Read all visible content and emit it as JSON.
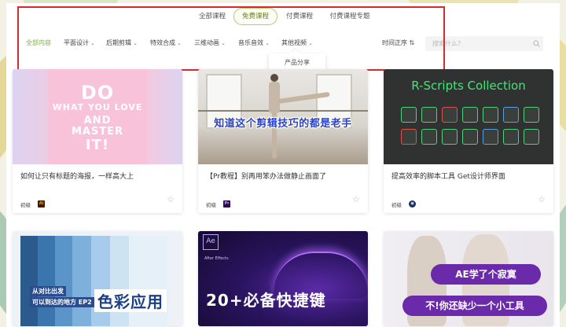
{
  "tabs": [
    {
      "label": "全部课程",
      "active": false
    },
    {
      "label": "免费课程",
      "active": true
    },
    {
      "label": "付费课程",
      "active": false
    },
    {
      "label": "付费课程专题",
      "active": false
    }
  ],
  "filters": [
    {
      "label": "全部内容",
      "active": true,
      "has_chevron": false
    },
    {
      "label": "平面设计",
      "active": false,
      "has_chevron": true
    },
    {
      "label": "后期剪辑",
      "active": false,
      "has_chevron": true
    },
    {
      "label": "特效合成",
      "active": false,
      "has_chevron": true
    },
    {
      "label": "三维动画",
      "active": false,
      "has_chevron": true
    },
    {
      "label": "音乐音效",
      "active": false,
      "has_chevron": true
    },
    {
      "label": "其他视频",
      "active": false,
      "has_chevron": true
    }
  ],
  "sort": {
    "label": "时间正序",
    "icon": "sort-arrows-icon"
  },
  "search": {
    "placeholder": "搜索什么?",
    "value": "",
    "icon": "search-icon"
  },
  "dropdown": {
    "item": "产品分享"
  },
  "colors": {
    "accent": "#7ab32a",
    "highlight": "#e0262d",
    "active_tab_border": "#b5c97a"
  },
  "cards": [
    {
      "title": "如何让只有标题的海报，一样高大上",
      "level": "初级",
      "app": "Ai",
      "app_color": "#3a1d00",
      "thumb_text": [
        "DO",
        "WHAT YOU LOVE",
        "AND",
        "MASTER",
        "IT!"
      ]
    },
    {
      "title": "【Pr教程】别再用笨办法做静止画面了",
      "level": "初级",
      "app": "Pr",
      "app_color": "#2a0a4a",
      "thumb_text": [
        "知道这个剪辑技巧的都是老手"
      ]
    },
    {
      "title": "提高效率的脚本工具 Get设计师界面",
      "level": "初级",
      "app": "C4",
      "app_color": "#1d2f55",
      "thumb_text": [
        "R-Scripts Collection"
      ]
    },
    {
      "title": "",
      "level": "",
      "app": "",
      "app_color": "",
      "thumb_text": [
        "从对比出发",
        "可以到达的地方 EP2",
        "色彩应用"
      ]
    },
    {
      "title": "",
      "level": "",
      "app": "",
      "app_color": "",
      "thumb_text": [
        "Ae",
        "After Effects",
        "20+必备快捷键"
      ]
    },
    {
      "title": "",
      "level": "",
      "app": "",
      "app_color": "",
      "thumb_text": [
        "AE学了个寂寞",
        "不!你还缺少一个小工具"
      ]
    }
  ]
}
